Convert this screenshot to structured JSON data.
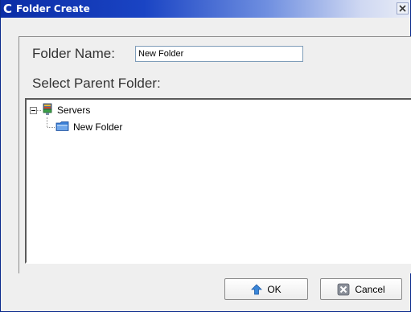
{
  "window": {
    "title": "Folder Create",
    "app_icon": "C",
    "close_label": "×"
  },
  "form": {
    "folder_name_label": "Folder Name:",
    "folder_name_value": "New Folder",
    "parent_label": "Select Parent Folder:"
  },
  "tree": {
    "root": {
      "label": "Servers",
      "icon": "servers-icon",
      "expanded": true
    },
    "children": [
      {
        "label": "New Folder",
        "icon": "folder-icon"
      }
    ]
  },
  "buttons": {
    "ok": {
      "label": "OK",
      "icon": "arrow-up-icon"
    },
    "cancel": {
      "label": "Cancel",
      "icon": "cancel-x-icon"
    }
  },
  "colors": {
    "titlebar_start": "#0b2da6",
    "titlebar_end": "#e8ecf6",
    "window_bg": "#efefef",
    "folder_blue": "#3b7fd6",
    "ok_arrow": "#3a86d8"
  }
}
